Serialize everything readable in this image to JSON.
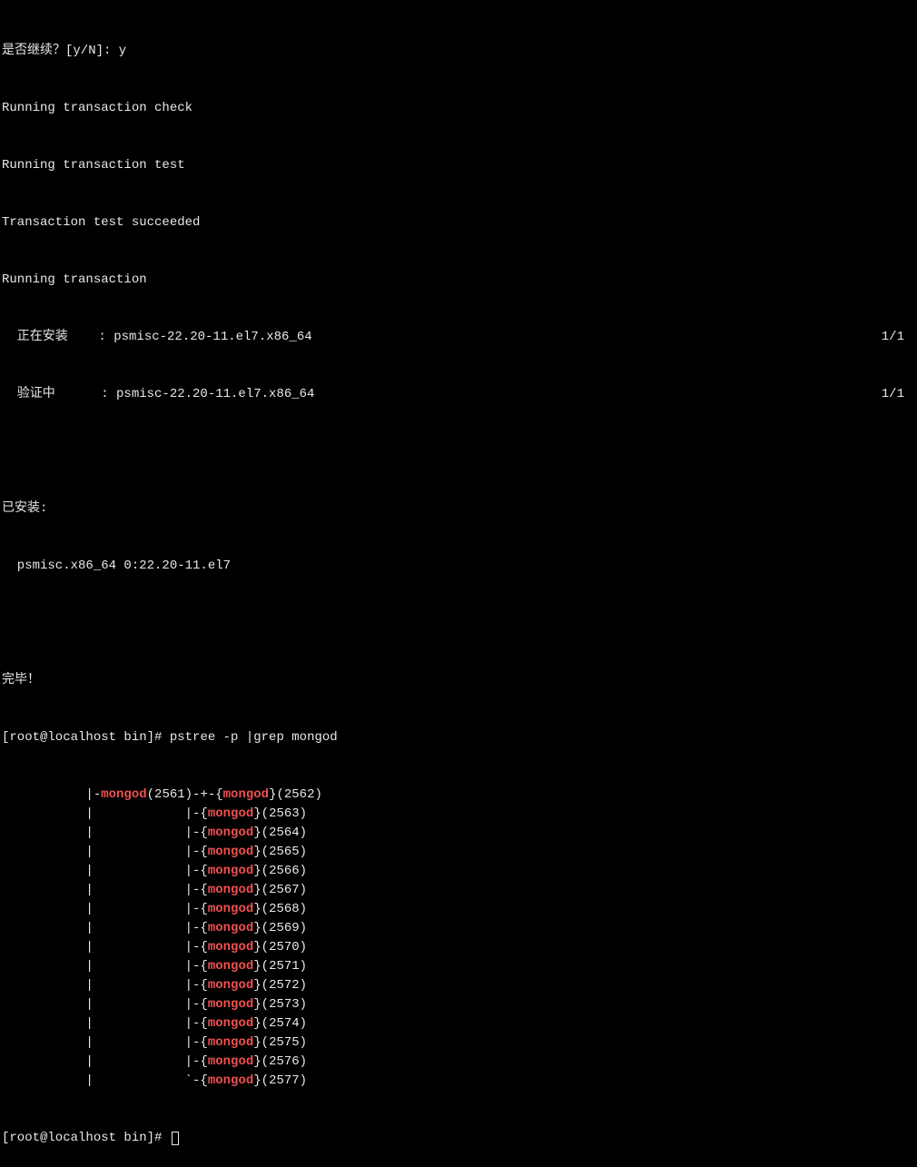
{
  "lines": {
    "continue_prompt": "是否继续？[y/N]: y",
    "running_check": "Running transaction check",
    "running_test": "Running transaction test",
    "test_succeeded": "Transaction test succeeded",
    "running_trans": "Running transaction",
    "installing_label": "  正在安装    : psmisc-22.20-11.el7.x86_64",
    "installing_count": "1/1",
    "verifying_label": "  验证中      : psmisc-22.20-11.el7.x86_64",
    "verifying_count": "1/1",
    "installed_header": "已安装:",
    "installed_pkg": "  psmisc.x86_64 0:22.20-11.el7",
    "complete": "完毕！",
    "prompt1_pre": "[root@localhost bin]# ",
    "prompt1_cmd": "pstree -p |grep mongod",
    "prompt2_pre": "[root@localhost bin]# "
  },
  "pstree": {
    "parent_pid": "2561",
    "parent_name": "mongod",
    "child_name": "mongod",
    "first_child_pid": "2562",
    "children": [
      {
        "pid": "2563",
        "last": false
      },
      {
        "pid": "2564",
        "last": false
      },
      {
        "pid": "2565",
        "last": false
      },
      {
        "pid": "2566",
        "last": false
      },
      {
        "pid": "2567",
        "last": false
      },
      {
        "pid": "2568",
        "last": false
      },
      {
        "pid": "2569",
        "last": false
      },
      {
        "pid": "2570",
        "last": false
      },
      {
        "pid": "2571",
        "last": false
      },
      {
        "pid": "2572",
        "last": false
      },
      {
        "pid": "2573",
        "last": false
      },
      {
        "pid": "2574",
        "last": false
      },
      {
        "pid": "2575",
        "last": false
      },
      {
        "pid": "2576",
        "last": false
      },
      {
        "pid": "2577",
        "last": true
      }
    ]
  }
}
